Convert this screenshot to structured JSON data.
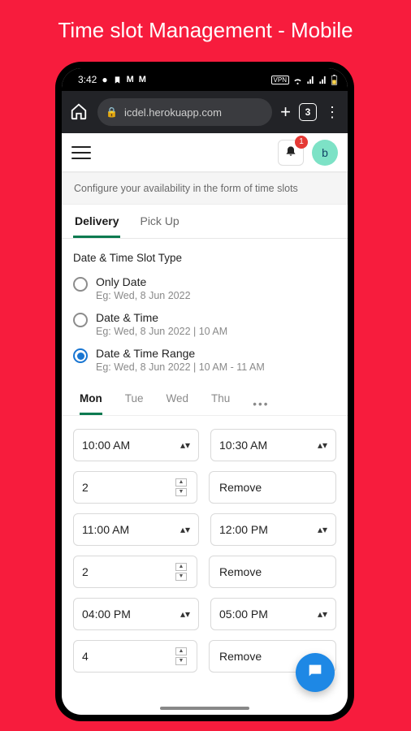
{
  "page_heading": "Time slot Management - Mobile",
  "status": {
    "time": "3:42",
    "icons_left": [
      "circle-icon",
      "bookmark-icon",
      "gmail-m1-icon",
      "gmail-m2-icon"
    ],
    "icons_right": [
      "vpn-icon",
      "wifi-icon",
      "signal-icon",
      "signal2-icon",
      "battery-icon"
    ]
  },
  "browser": {
    "url_display": "icdel.herokuapp.com",
    "tab_count": "3"
  },
  "appheader": {
    "notification_count": "1",
    "avatar_initial": "b"
  },
  "banner": "Configure your availability in the form of time slots",
  "major_tabs": [
    {
      "label": "Delivery",
      "active": true
    },
    {
      "label": "Pick Up",
      "active": false
    }
  ],
  "section_label": "Date & Time Slot Type",
  "radios": [
    {
      "label": "Only Date",
      "example": "Eg: Wed, 8 Jun 2022",
      "selected": false
    },
    {
      "label": "Date & Time",
      "example": "Eg: Wed, 8 Jun 2022 | 10 AM",
      "selected": false
    },
    {
      "label": "Date & Time Range",
      "example": "Eg: Wed, 8 Jun 2022 | 10 AM - 11 AM",
      "selected": true
    }
  ],
  "day_tabs": {
    "items": [
      "Mon",
      "Tue",
      "Wed",
      "Thu"
    ],
    "active_index": 0,
    "overflow": "•••"
  },
  "slots": {
    "remove_label": "Remove",
    "rows": [
      {
        "start": "10:00 AM",
        "end": "10:30 AM",
        "qty": "2"
      },
      {
        "start": "11:00 AM",
        "end": "12:00 PM",
        "qty": "2"
      },
      {
        "start": "04:00 PM",
        "end": "05:00 PM",
        "qty": "4"
      }
    ]
  }
}
